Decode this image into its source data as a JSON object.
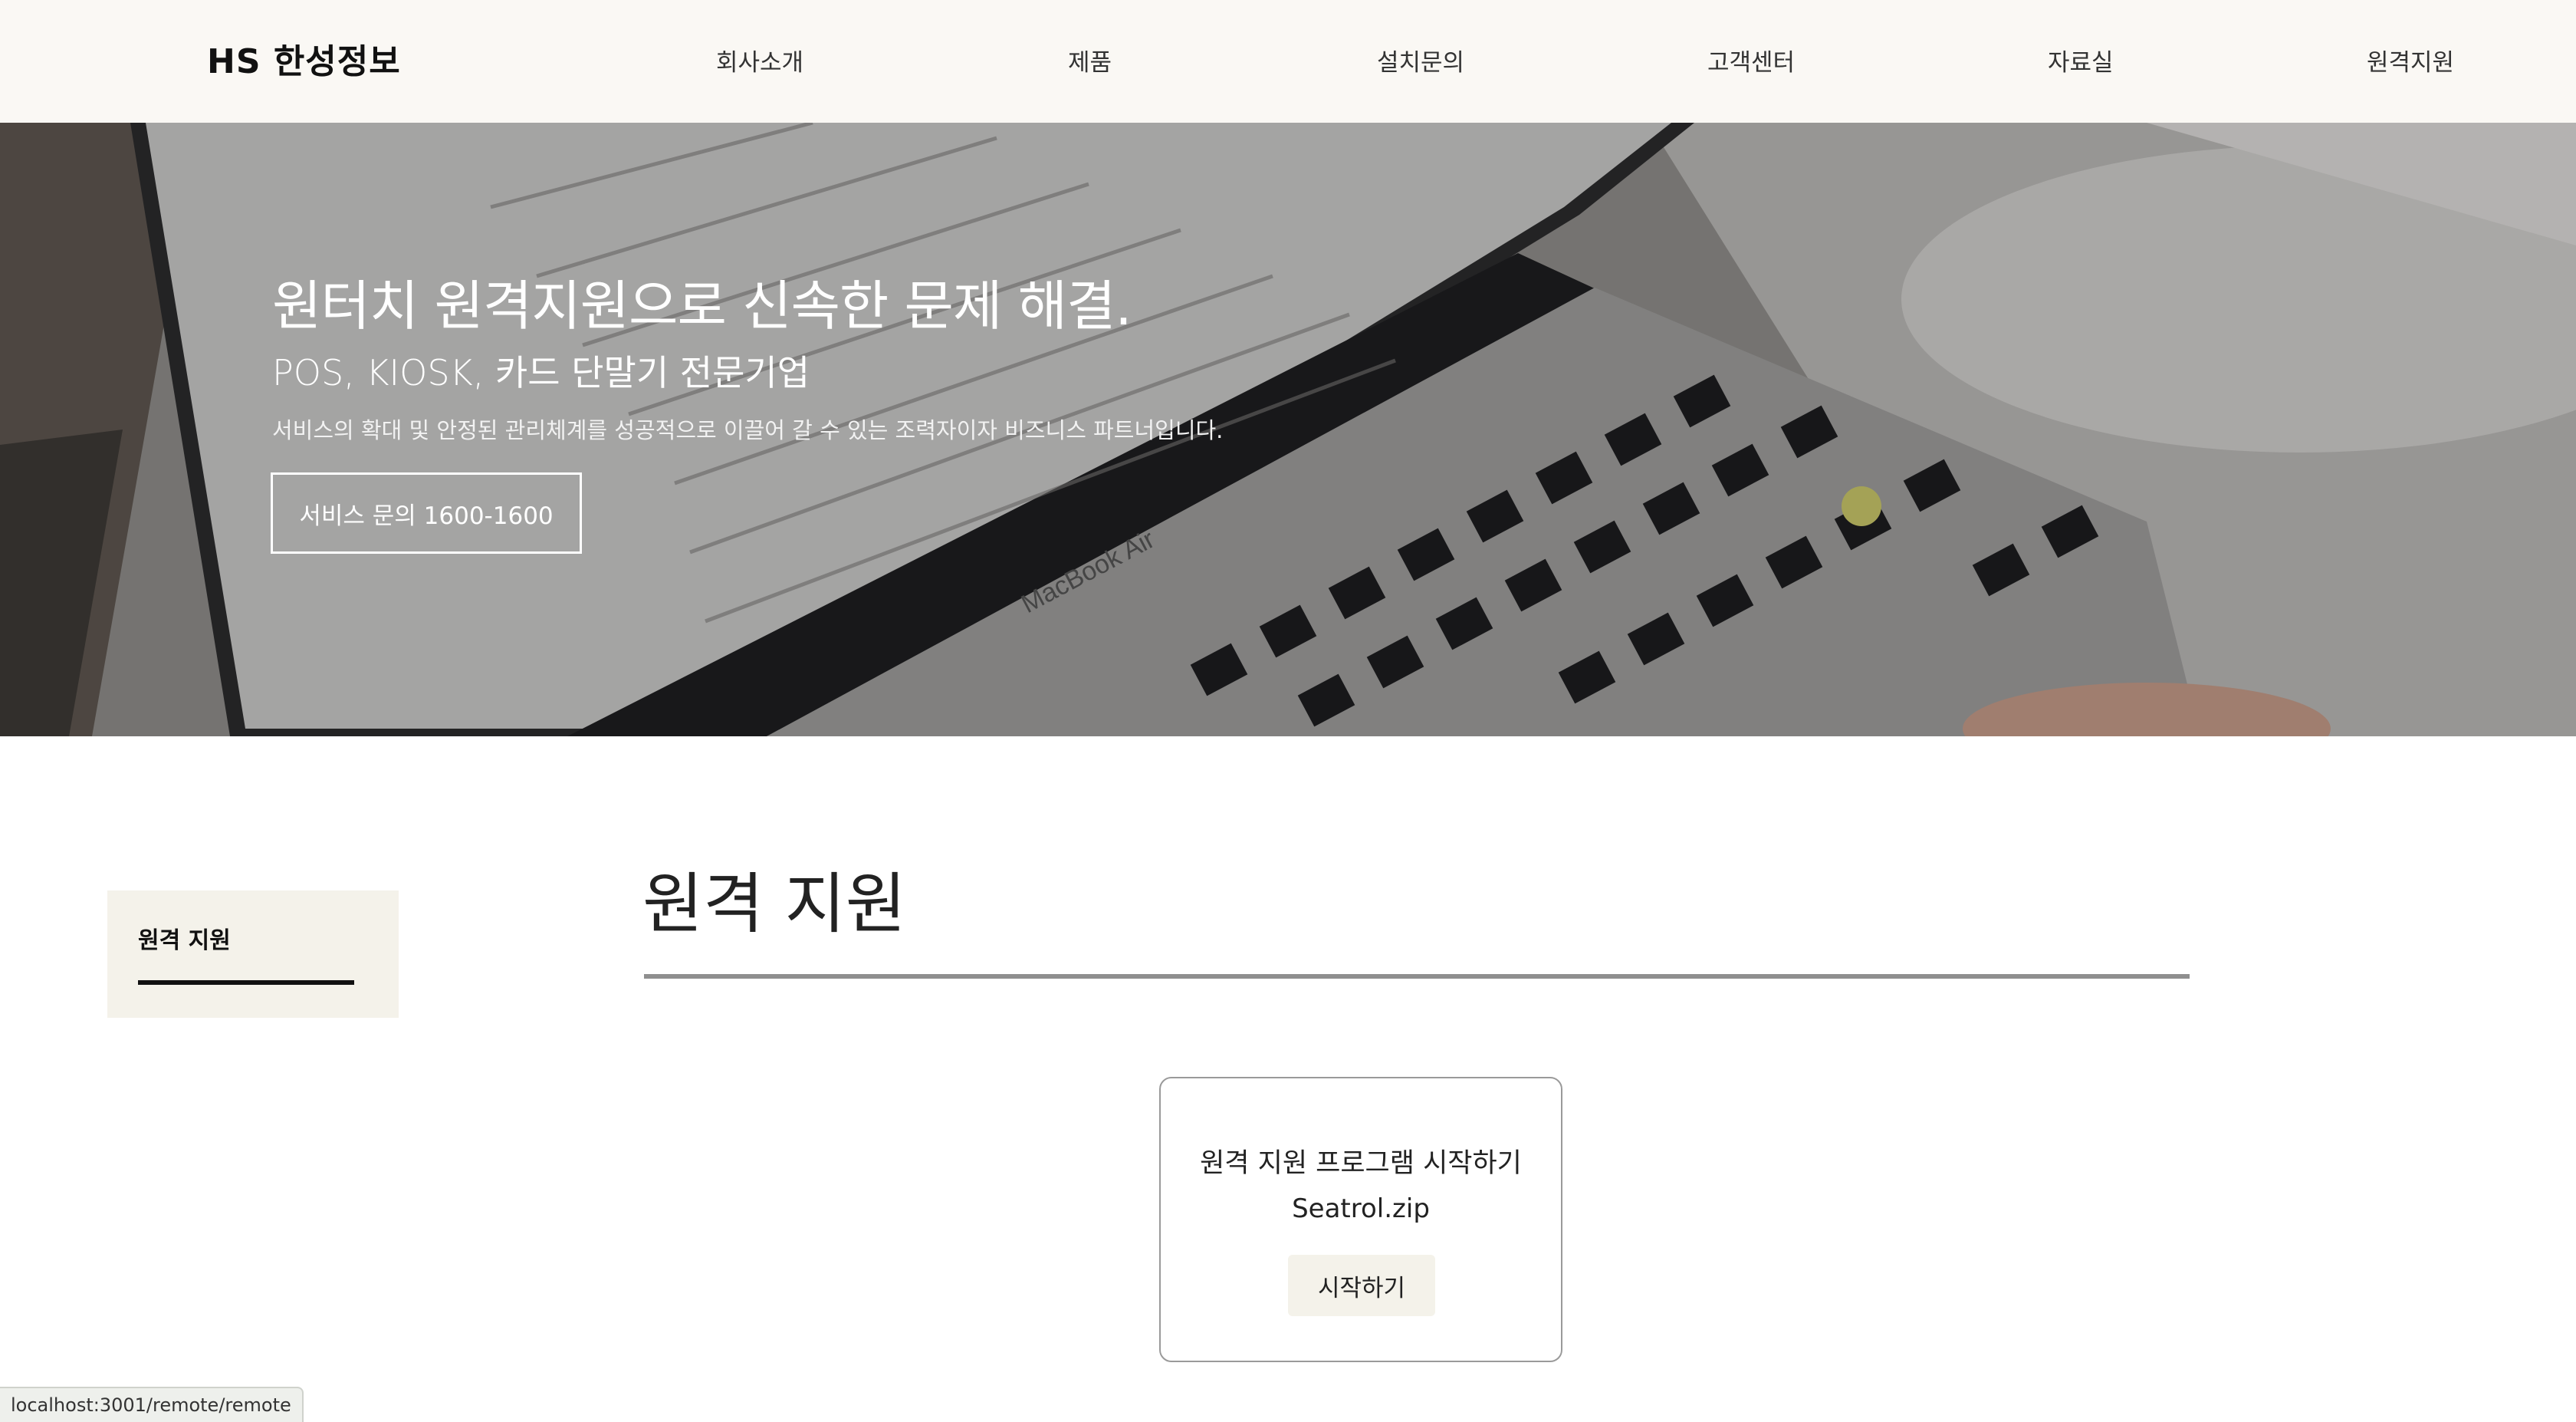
{
  "header": {
    "logo": "HS 한성정보",
    "nav": [
      {
        "label": "회사소개"
      },
      {
        "label": "제품"
      },
      {
        "label": "설치문의"
      },
      {
        "label": "고객센터"
      },
      {
        "label": "자료실"
      },
      {
        "label": "원격지원"
      }
    ]
  },
  "hero": {
    "title": "원터치 원격지원으로 신속한 문제 해결.",
    "subtitle": "POS, KIOSK, 카드 단말기 전문기업",
    "description": "서비스의 확대 및 안정된 관리체계를 성공적으로 이끌어 갈 수 있는 조력자이자 비즈니스 파트너입니다.",
    "button_label": "서비스 문의 1600-1600",
    "laptop_brand_text": "MacBook Air"
  },
  "sidebar": {
    "items": [
      {
        "label": "원격 지원"
      }
    ]
  },
  "main": {
    "title": "원격 지원",
    "card": {
      "title": "원격 지원 프로그램 시작하기",
      "filename": "Seatrol.zip",
      "button_label": "시작하기"
    }
  },
  "statusbar": {
    "url": "localhost:3001/remote/remote"
  },
  "colors": {
    "header_bg": "#faf8f4",
    "sidebar_bg": "#f4f2ea",
    "button_bg": "#f4f2ea",
    "rule": "#8f8f8f"
  }
}
